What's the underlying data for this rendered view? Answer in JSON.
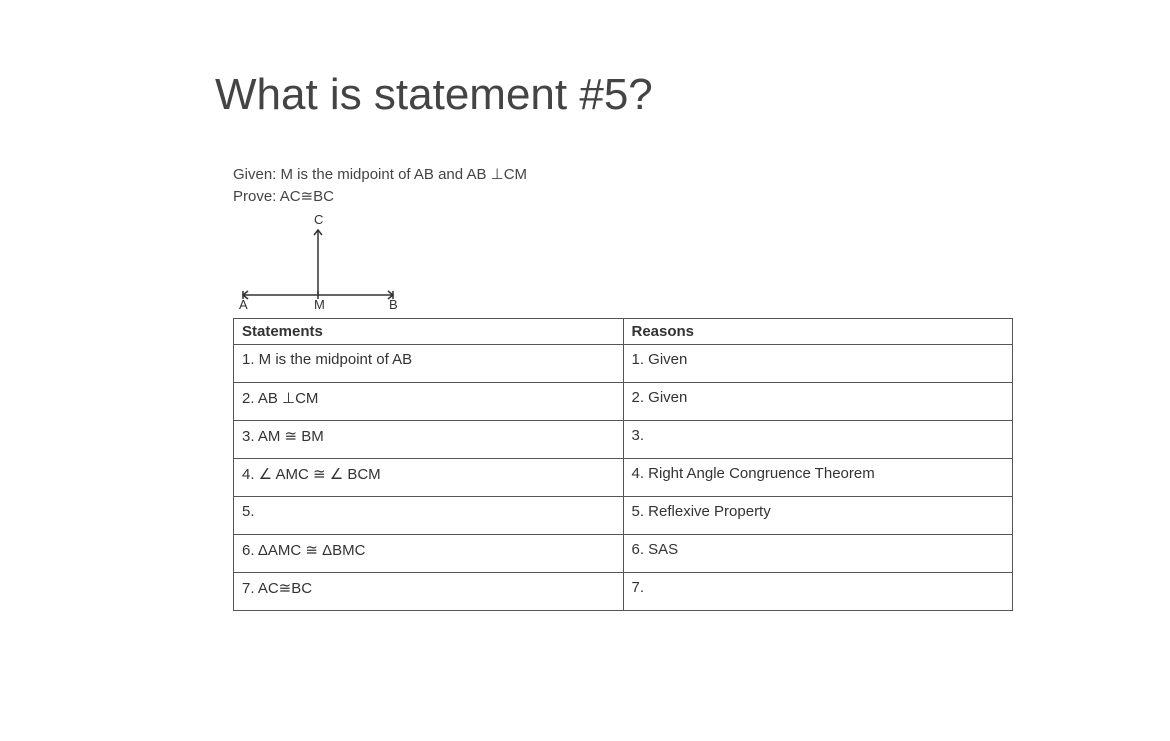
{
  "title": "What is statement #5?",
  "given": "Given: M is the midpoint of AB and AB ⊥CM",
  "prove": "Prove: AC≅BC",
  "diagram": {
    "labels": {
      "A": "A",
      "M": "M",
      "B": "B",
      "C": "C"
    }
  },
  "table": {
    "headers": {
      "statements": "Statements",
      "reasons": "Reasons"
    },
    "rows": [
      {
        "statement": "1.  M is the midpoint of AB",
        "reason": "1. Given"
      },
      {
        "statement": "2.  AB ⊥CM",
        "reason": "2. Given"
      },
      {
        "statement": "3.  AM ≅ BM",
        "reason": "3."
      },
      {
        "statement": "4. ∠ AMC  ≅  ∠ BCM",
        "reason": "4.  Right Angle Congruence Theorem"
      },
      {
        "statement": "5.",
        "reason": "5. Reflexive Property"
      },
      {
        "statement": "6.   ΔAMC ≅ ΔBMC",
        "reason": "6. SAS"
      },
      {
        "statement": "7. AC≅BC",
        "reason": "7."
      }
    ]
  }
}
